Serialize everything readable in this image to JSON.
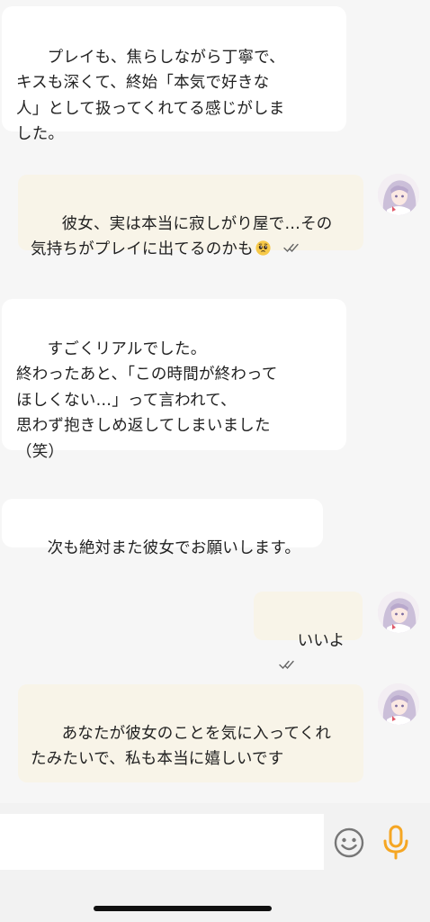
{
  "messages": [
    {
      "side": "in",
      "text": "プレイも、焦らしながら丁寧で、\nキスも深くて、終始「本気で好きな\n人」として扱ってくれてる感じがしま\nした。"
    },
    {
      "side": "out",
      "text": "彼女、実は本当に寂しがり屋で…その\n気持ちがプレイに出てるのかも",
      "emoji": "pleading-face-emoji",
      "status": "read"
    },
    {
      "side": "in",
      "text": "すごくリアルでした。\n終わったあと、「この時間が終わって\nほしくない…」って言われて、\n思わず抱きしめ返してしまいました\n（笑）"
    },
    {
      "side": "in",
      "text": "次も絶対また彼女でお願いします。"
    },
    {
      "side": "out",
      "text": "いいよ",
      "status": "read"
    },
    {
      "side": "out",
      "text": "あなたが彼女のことを気に入ってくれ\nたみたいで、私も本当に嬉しいです",
      "status": "read"
    }
  ],
  "input": {
    "placeholder": "",
    "emoji_button_icon": "smiley-face-icon",
    "mic_button_icon": "microphone-icon",
    "mic_color": "#f5a623"
  },
  "colors": {
    "incoming_bubble": "#ffffff",
    "outgoing_bubble": "#f8f4e8",
    "background": "#f6f6f6",
    "tick_color": "#666666"
  }
}
